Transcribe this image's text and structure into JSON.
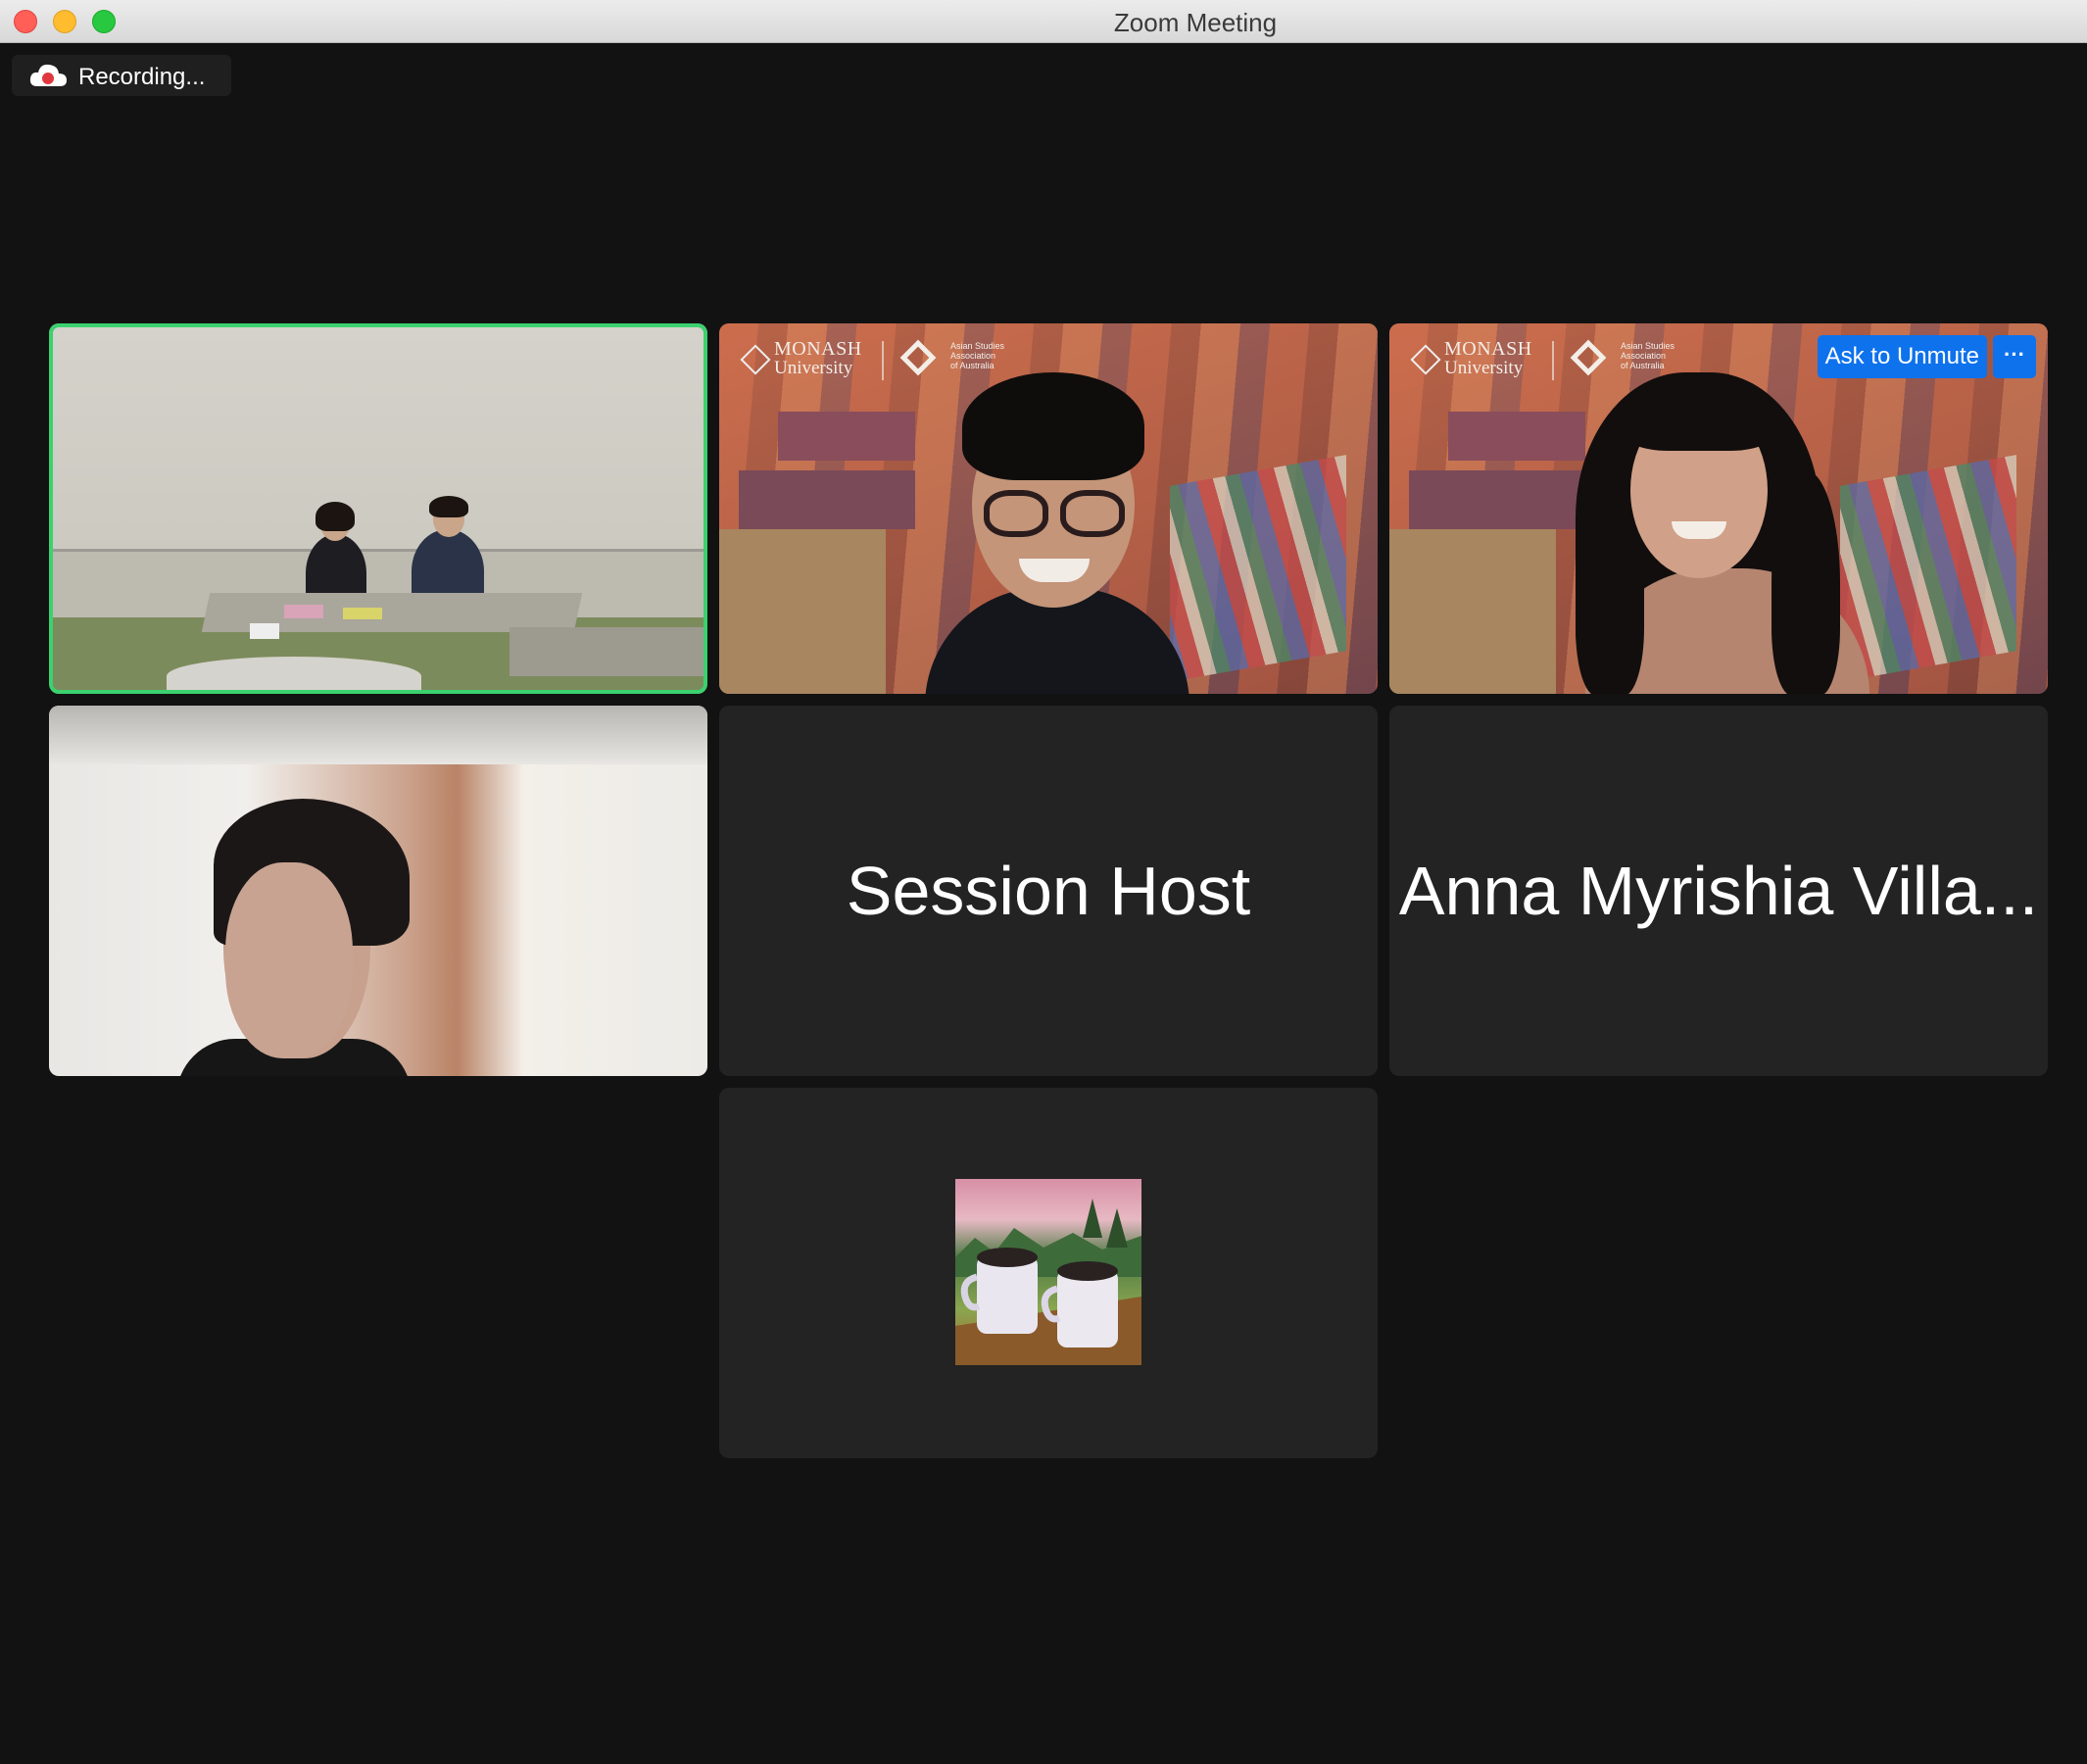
{
  "window": {
    "title": "Zoom Meeting"
  },
  "recording": {
    "label": "Recording..."
  },
  "tiles": [
    {
      "type": "video",
      "scene": "classroom",
      "active_speaker": true
    },
    {
      "type": "video",
      "scene": "presenter-glasses",
      "brand": {
        "org": "MONASH",
        "sub": "University",
        "assoc": [
          "Asian Studies",
          "Association",
          "of Australia"
        ]
      }
    },
    {
      "type": "video",
      "scene": "presenter-long-hair",
      "brand": {
        "org": "MONASH",
        "sub": "University",
        "assoc": [
          "Asian Studies",
          "Association",
          "of Australia"
        ]
      },
      "actions": {
        "ask_to_unmute": "Ask to Unmute",
        "more": "···"
      }
    },
    {
      "type": "video",
      "scene": "blurred-background"
    },
    {
      "type": "name",
      "name": "Session Host"
    },
    {
      "type": "name",
      "name": "Anna Myrishia Villa..."
    },
    {
      "type": "avatar",
      "avatar": "coffee-mugs-painting"
    }
  ],
  "colors": {
    "active_speaker_border": "#3bd16f",
    "zoom_blue": "#0e72ed",
    "tile_bg": "#232323",
    "window_bg": "#121212"
  }
}
